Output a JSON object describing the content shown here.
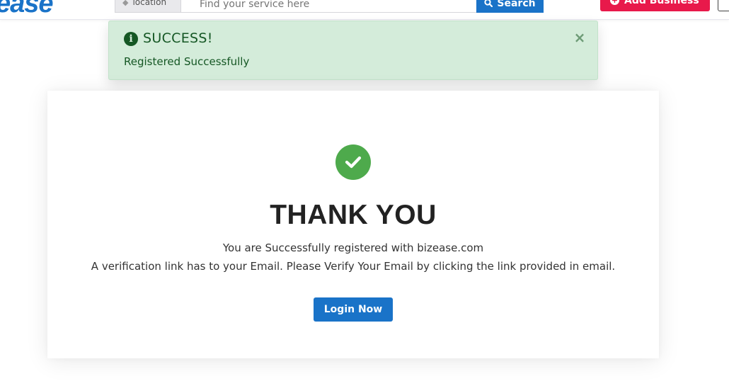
{
  "header": {
    "logo_text": "ease",
    "location_placeholder": "location",
    "search_placeholder": "Find your service here",
    "search_button": "Search",
    "add_business_button": "Add Business",
    "brand_color": "#1a73c8",
    "accent_color": "#e8194b"
  },
  "alert": {
    "icon": "info-circle-icon",
    "title": "SUCCESS!",
    "message": "Registered Successfully",
    "close_symbol": "×",
    "background": "#d4ecda"
  },
  "main": {
    "status_icon": "check-circle-icon",
    "title": "THANK YOU",
    "line1": "You are Successfully registered with bizease.com",
    "line2": "A verification link has to your Email. Please Verify Your Email by clicking the link provided in email.",
    "login_button": "Login Now",
    "success_color": "#4eaa4c"
  }
}
